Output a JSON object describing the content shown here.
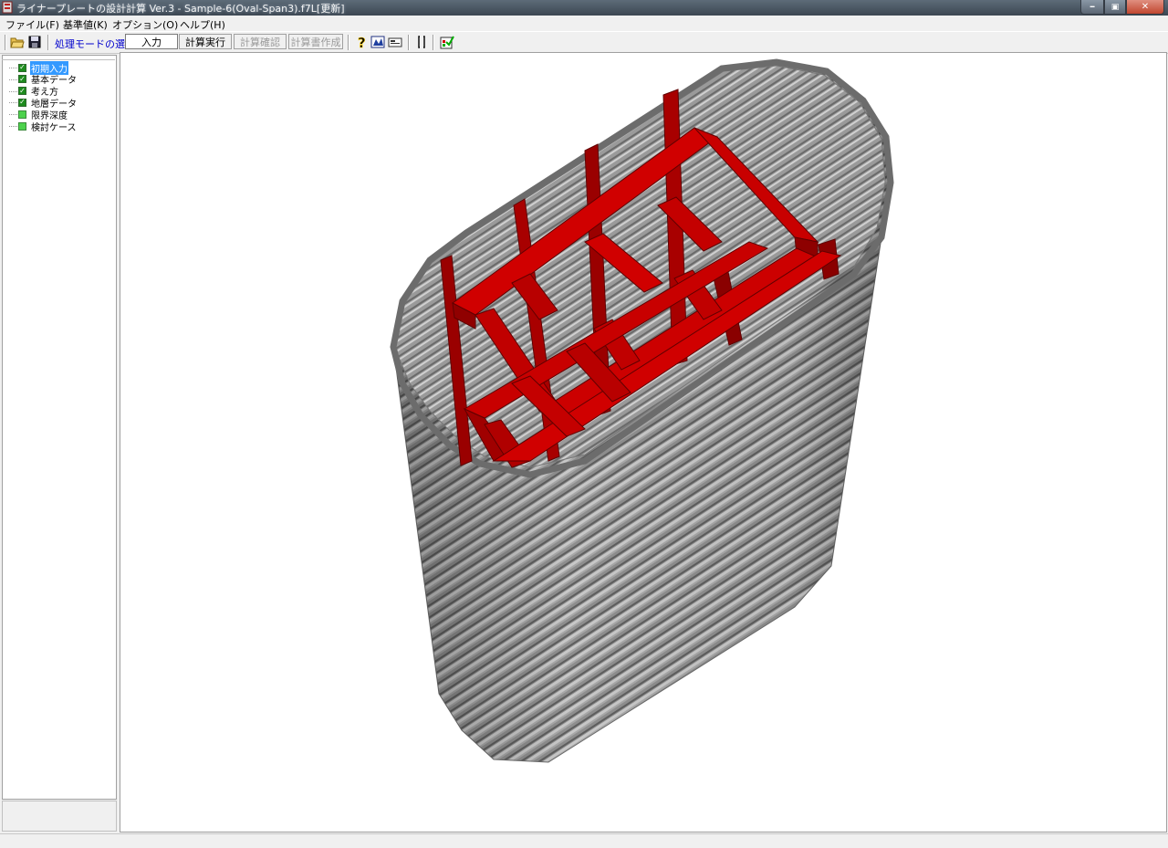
{
  "window": {
    "title": "ライナープレートの設計計算 Ver.3 - Sample-6(Oval-Span3).f7L[更新]",
    "min_glyph": "━",
    "max_glyph": "▣",
    "close_glyph": "✕"
  },
  "menu": {
    "file": "ファイル(F)",
    "standard": "基準値(K)",
    "options": "オプション(O)",
    "help": "ヘルプ(H)"
  },
  "toolbar": {
    "mode_label": "処理モードの選択",
    "input_label": "入力",
    "calc_run_label": "計算実行",
    "calc_check_label": "計算確認",
    "report_label": "計算書作成",
    "icons": [
      "open-folder-icon",
      "save-disk-icon",
      "help-question-icon",
      "model-view-icon",
      "card-icon",
      "bracket-icon",
      "checklist-icon"
    ]
  },
  "tree": {
    "items": [
      {
        "label": "初期入力",
        "checked": true,
        "selected": true
      },
      {
        "label": "基本データ",
        "checked": true,
        "selected": false
      },
      {
        "label": "考え方",
        "checked": true,
        "selected": false
      },
      {
        "label": "地層データ",
        "checked": true,
        "selected": false
      },
      {
        "label": "限界深度",
        "checked": false,
        "selected": false
      },
      {
        "label": "検討ケース",
        "checked": false,
        "selected": false
      }
    ]
  },
  "viewport": {
    "shaft_color": "#8c8c8c",
    "frame_color": "#c00000"
  }
}
